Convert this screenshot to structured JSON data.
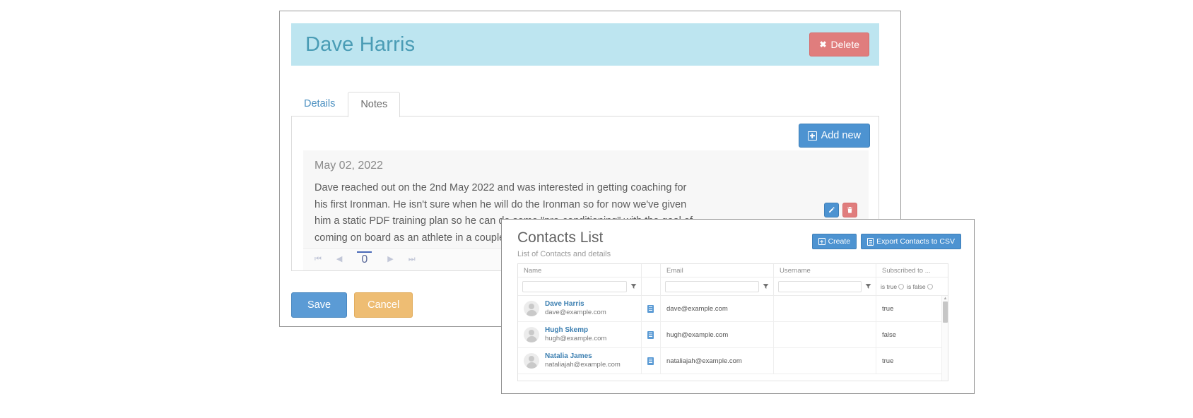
{
  "contact_card": {
    "title": "Dave Harris",
    "delete_button": "Delete",
    "tabs": [
      {
        "label": "Details",
        "active": false
      },
      {
        "label": "Notes",
        "active": true
      }
    ],
    "add_new_button": "Add new",
    "note": {
      "date": "May 02, 2022",
      "text": "Dave reached out on the 2nd May 2022 and was interested in getting coaching for his first Ironman. He isn't sure when he will do the Ironman so for now we've given him a static PDF training plan so he can do some \"pre-conditioning\" with the goal of coming on board as an athlete in a couple of months"
    },
    "pager": {
      "first": "⏮",
      "prev": "◀",
      "page": "0",
      "next": "▶",
      "last": "⏭"
    },
    "footer": {
      "save": "Save",
      "cancel": "Cancel"
    }
  },
  "contacts_panel": {
    "title": "Contacts List",
    "subtitle": "List of Contacts and details",
    "create_button": "Create",
    "export_button": "Export Contacts to CSV",
    "grid": {
      "columns": [
        "Name",
        "",
        "Email",
        "Username",
        "Subscribed to ..."
      ],
      "filters": {
        "name_value": "",
        "email_value": "",
        "username_value": "",
        "bool_true_label": "is true",
        "bool_false_label": "is false"
      },
      "rows": [
        {
          "name": "Dave Harris",
          "name_sub": "dave@example.com",
          "email": "dave@example.com",
          "username": "",
          "subscribed": "true"
        },
        {
          "name": "Hugh Skemp",
          "name_sub": "hugh@example.com",
          "email": "hugh@example.com",
          "username": "",
          "subscribed": "false"
        },
        {
          "name": "Natalia James",
          "name_sub": "nataliajah@example.com",
          "email": "nataliajah@example.com",
          "username": "",
          "subscribed": "true"
        }
      ]
    }
  },
  "colors": {
    "header_bg": "#bde5f0",
    "header_text": "#4a9cb5",
    "primary": "#4d93d1",
    "danger": "#e07d7d",
    "warning": "#eebd73",
    "link": "#3c7fb1"
  }
}
